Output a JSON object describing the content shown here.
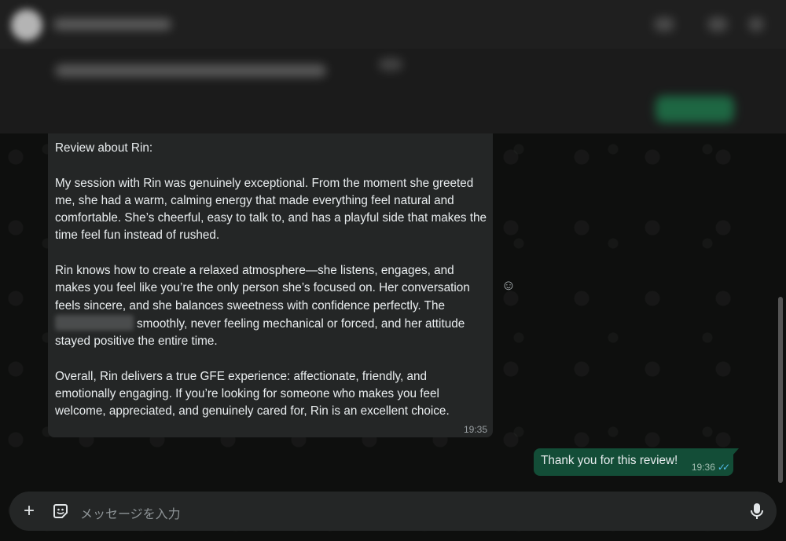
{
  "chat": {
    "incoming": {
      "title": "Review about Rin:",
      "para1": "My session with Rin was genuinely exceptional. From the moment she greeted me, she had a warm, calming energy that made everything feel natural and comfortable. She’s cheerful, easy to talk to, and has a playful side that makes the time feel fun instead of rushed.",
      "para2_start": "Rin knows how to create a relaxed atmosphere—she listens, engages, and makes you feel like you’re the only person she’s focused on. Her conversation feels sincere, and she balances sweetness with confidence perfectly. The",
      "para2_end": "smoothly, never feeling mechanical or forced, and her attitude stayed positive the entire time.",
      "para3": "Overall, Rin delivers a true GFE experience: affectionate, friendly, and emotionally engaging. If you’re looking for someone who makes you feel welcome, appreciated, and genuinely cared for, Rin is an excellent choice.",
      "time": "19:35"
    },
    "outgoing": {
      "text": "Thank you for this review!",
      "time": "19:36",
      "ticks": "✓✓"
    }
  },
  "composer": {
    "placeholder": "メッセージを入力",
    "add_icon": "+",
    "sticker_icon": "sticker-icon",
    "mic_icon": "mic-icon"
  },
  "colors": {
    "incoming_bubble": "#242626",
    "outgoing_bubble": "#134d37",
    "read_ticks": "#53bdeb"
  }
}
